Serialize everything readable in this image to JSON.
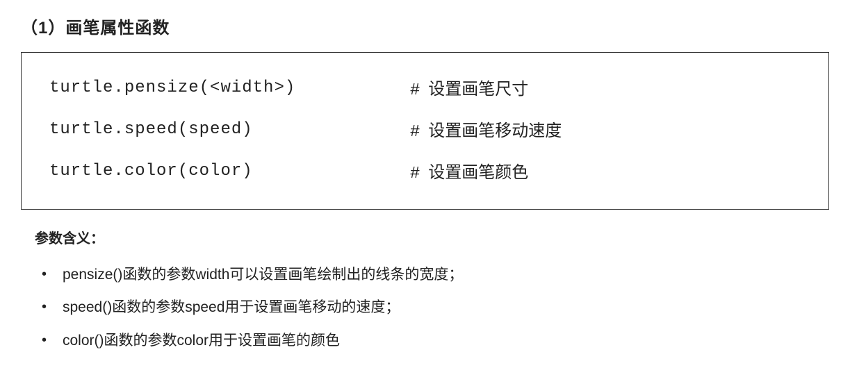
{
  "heading": "（1）画笔属性函数",
  "code_rows": [
    {
      "code": "turtle.pensize(<width>)",
      "comment": "设置画笔尺寸"
    },
    {
      "code": "turtle.speed(speed)",
      "comment": "设置画笔移动速度"
    },
    {
      "code": "turtle.color(color)",
      "comment": "设置画笔颜色"
    }
  ],
  "hash": "#",
  "sub_heading": "参数含义：",
  "bullets": [
    "pensize()函数的参数width可以设置画笔绘制出的线条的宽度；",
    "speed()函数的参数speed用于设置画笔移动的速度；",
    "color()函数的参数color用于设置画笔的颜色"
  ]
}
